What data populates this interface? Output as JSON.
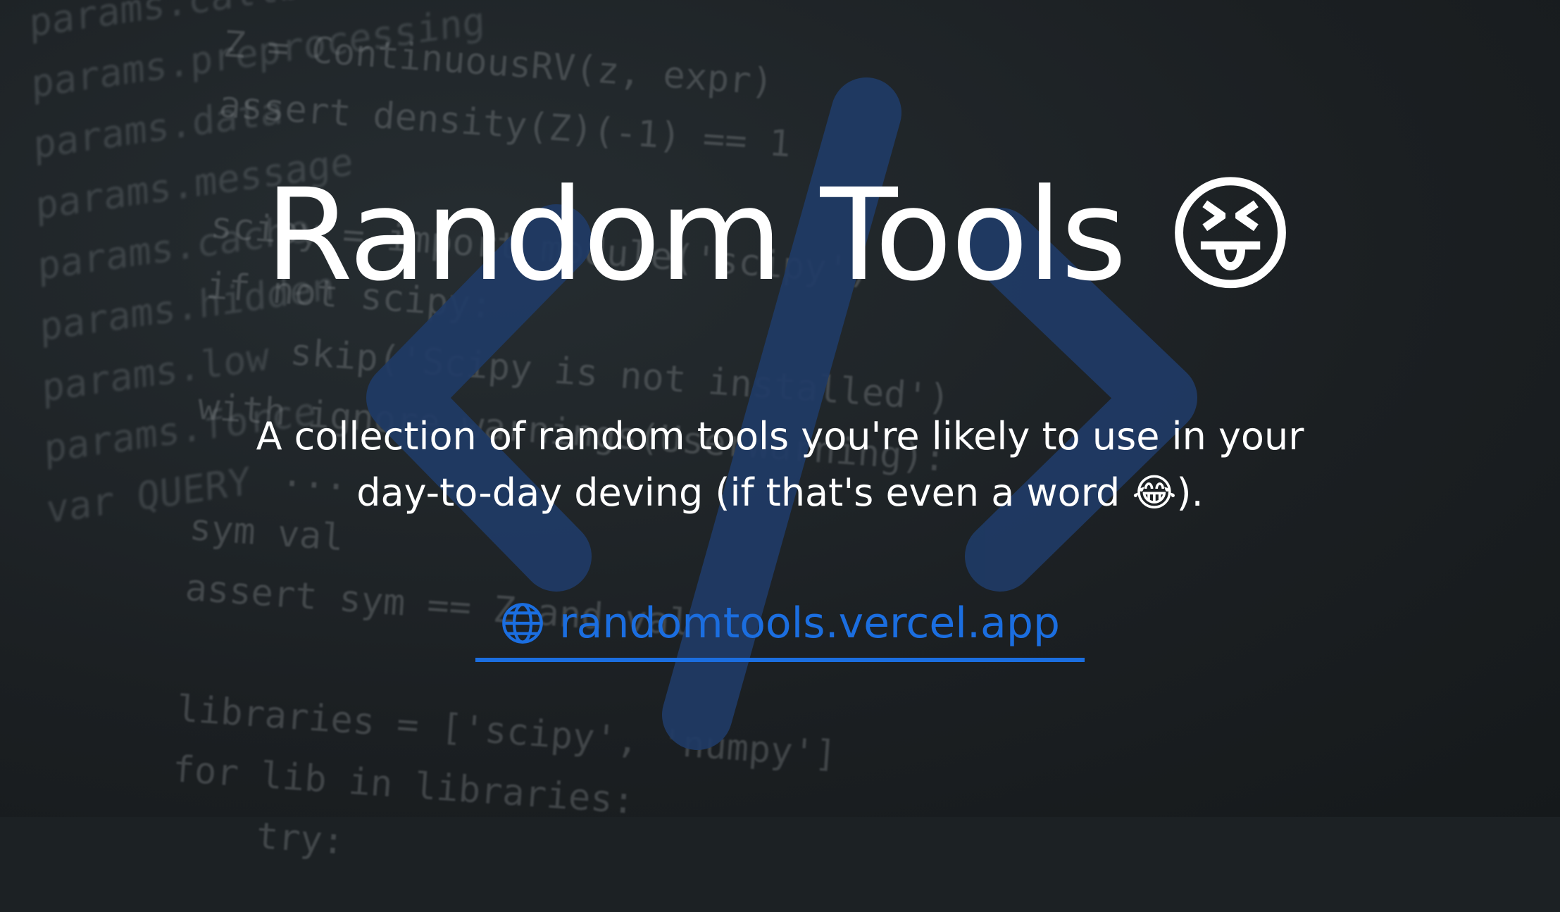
{
  "title": "Random Tools 😝",
  "subtitle_line1": "A collection of random tools you're likely to use in your",
  "subtitle_line2": "day-to-day deving (if that's even a word 😂).",
  "link": {
    "icon": "globe-icon",
    "label": "randomtools.vercel.app"
  },
  "background_code": {
    "left": [
      "params.callback",
      "params.preprocessing",
      "params.data",
      "params.message",
      "params.cache",
      "params.hidden",
      "params.low",
      "params.force",
      "var QUERY"
    ],
    "right": [
      "Z = ContinuousRV(z, expr)",
      "assert density(Z)(-1) == 1",
      "",
      "scipy = import_module('scipy')",
      "if not scipy:",
      "    skip('Scipy is not installed')",
      "with ignore_warnings(UserWarning):",
      "    ...",
      "sym val",
      "assert sym == Z and val",
      "",
      "libraries = ['scipy', 'numpy']",
      "for lib in libraries:",
      "    try:"
    ]
  },
  "colors": {
    "accent": "#1b6ee0",
    "logo": "#1f3b66",
    "background": "#1c2124"
  }
}
